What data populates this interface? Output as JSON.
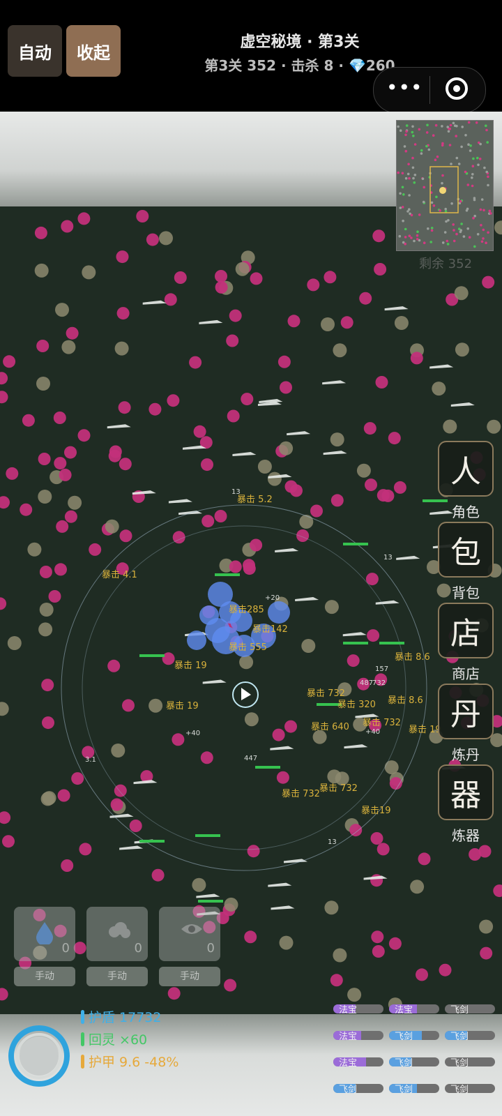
{
  "header": {
    "auto_label": "自动",
    "collapse_label": "收起",
    "title": "虚空秘境 · 第3关",
    "subtitle": "第3关 352 · 击杀 8 · 💎260"
  },
  "minimap": {
    "remaining": "剩余 352"
  },
  "side_menu": [
    {
      "glyph": "人",
      "label": "角色"
    },
    {
      "glyph": "包",
      "label": "背包"
    },
    {
      "glyph": "店",
      "label": "商店"
    },
    {
      "glyph": "丹",
      "label": "炼丹"
    },
    {
      "glyph": "器",
      "label": "炼器"
    }
  ],
  "floating_texts": [
    "暴击 5.2",
    "暴击 4.1",
    "暴击285",
    "暴击142",
    "暴击 555",
    "暴击 19",
    "暴击 19",
    "暴击 8.6",
    "暴击 8.6",
    "暴击 732",
    "暴击 320",
    "暴击 732",
    "暴击 640",
    "暴击 732",
    "暴击 732",
    "暴击19",
    "暴击 19",
    "13",
    "13",
    "13",
    "447",
    "3.1",
    "+20",
    "+40",
    "+40",
    "487",
    "157",
    "732"
  ],
  "skills": [
    {
      "icon": "water-drop-icon",
      "count": "0",
      "manual": "手动"
    },
    {
      "icon": "cloud-icon",
      "count": "0",
      "manual": "手动"
    },
    {
      "icon": "eye-icon",
      "count": "0",
      "manual": "手动"
    }
  ],
  "stats": {
    "shield": "护盾 17732",
    "regen": "回灵 ×60",
    "armor": "护甲 9.6 -48%",
    "shield_color": "#3fb0e8",
    "regen_color": "#43c766",
    "armor_color": "#e6a93b"
  },
  "weapons": [
    [
      {
        "label": "法宝",
        "color": "#9b6cd8"
      },
      {
        "label": "法宝",
        "color": "#9b6cd8"
      },
      {
        "label": "飞剑",
        "color": "#777777"
      }
    ],
    [
      {
        "label": "法宝",
        "color": "#9b6cd8"
      },
      {
        "label": "飞剑",
        "color": "#5aa0e0"
      },
      {
        "label": "飞剑",
        "color": "#5aa0e0"
      }
    ],
    [
      {
        "label": "法宝",
        "color": "#9b6cd8"
      },
      {
        "label": "飞剑",
        "color": "#5aa0e0"
      },
      {
        "label": "飞剑",
        "color": "#777777"
      }
    ],
    [
      {
        "label": "飞剑",
        "color": "#5aa0e0"
      },
      {
        "label": "飞剑",
        "color": "#5aa0e0"
      },
      {
        "label": "飞剑",
        "color": "#777777"
      }
    ]
  ],
  "colors": {
    "enemy_pink": "#c2307a",
    "enemy_tan": "#8d8a6f",
    "crit_text": "#d9b23c",
    "orb_blue": "#5f8cf0"
  }
}
